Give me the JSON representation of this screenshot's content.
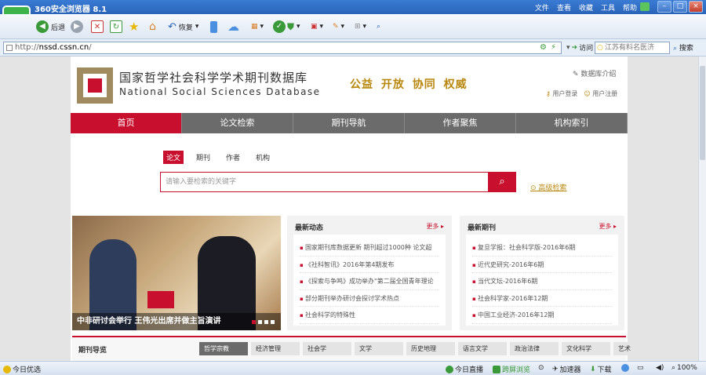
{
  "browser": {
    "title": "360安全浏览器 8.1",
    "menu": [
      "文件",
      "查看",
      "收藏",
      "工具",
      "帮助"
    ],
    "toolbar": {
      "back": "后退",
      "restore": "恢复"
    },
    "address": "http://nssd.cssn.cn/",
    "address_prefix": "http://",
    "address_domain": "nssd.cssn.cn",
    "address_suffix": "/",
    "visit": "访问",
    "search_placeholder": "江苏有料名医济",
    "search_button": "搜索",
    "status": {
      "today_pick": "今日优选",
      "live": "今日直播",
      "cut": "跨屏浏览",
      "accelerator": "加速器",
      "download": "下载",
      "zoom": "100%"
    }
  },
  "site": {
    "title_cn": "国家哲学社会科学学术期刊数据库",
    "title_en": "National Social Sciences Database",
    "slogan": "公益  开放  协同  权威",
    "db_intro": "数据库介绍",
    "login": "用户登录",
    "register": "用户注册",
    "nav": [
      "首页",
      "论文检索",
      "期刊导航",
      "作者聚焦",
      "机构索引"
    ],
    "search_tabs": [
      "论文",
      "期刊",
      "作者",
      "机构"
    ],
    "search_placeholder": "请输入要检索的关键字",
    "advanced_search": "高级检索",
    "feature_caption": "中非研讨会举行 王伟光出席并做主旨演讲",
    "news": {
      "title": "最新动态",
      "more": "更多",
      "items": [
        "国家期刊库数据更新 期刊超过1000种 论文超",
        "《社科智讯》2016年第4期发布",
        "《探索与争鸣》成功举办\"第二届全国青年理论",
        "部分期刊举办研讨会探讨学术热点",
        "社会科学的特殊性"
      ]
    },
    "journals": {
      "title": "最新期刊",
      "more": "更多",
      "items": [
        "复旦学报：社会科学版-2016年6期",
        "近代史研究-2016年6期",
        "当代文坛-2016年6期",
        "社会科学家-2016年12期",
        "中国工业经济-2016年12期"
      ]
    },
    "journal_guide": {
      "title": "期刊导览",
      "tabs": [
        "哲学宗教",
        "经济管理",
        "社会学",
        "文学",
        "历史地理",
        "语言文学",
        "政治法律",
        "文化科学",
        "艺术"
      ]
    }
  }
}
